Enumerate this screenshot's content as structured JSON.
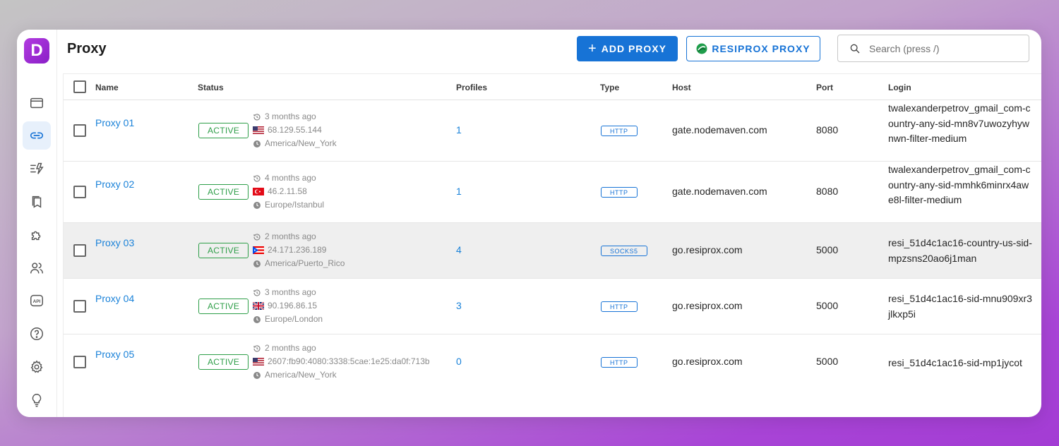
{
  "header": {
    "title": "Proxy",
    "add_button": "ADD PROXY",
    "resiprox_button": "RESIPROX PROXY",
    "search_placeholder": "Search (press /)"
  },
  "sidebar": {
    "logo_letter": "D",
    "items": [
      {
        "name": "browser-icon",
        "active": false
      },
      {
        "name": "link-icon",
        "active": true
      },
      {
        "name": "automation-icon",
        "active": false
      },
      {
        "name": "bookmarks-icon",
        "active": false
      },
      {
        "name": "puzzle-icon",
        "active": false
      },
      {
        "name": "users-icon",
        "active": false
      },
      {
        "name": "api-icon",
        "active": false
      },
      {
        "name": "help-icon",
        "active": false
      },
      {
        "name": "settings-icon",
        "active": false
      },
      {
        "name": "lightbulb-icon",
        "active": false
      }
    ]
  },
  "columns": {
    "name": "Name",
    "status": "Status",
    "profiles": "Profiles",
    "type": "Type",
    "host": "Host",
    "port": "Port",
    "login": "Login"
  },
  "colors": {
    "accent": "#1773d6",
    "active_green": "#2e9e48",
    "brand": "#a32bd6"
  },
  "rows": [
    {
      "name": "Proxy 01",
      "status": "ACTIVE",
      "updated": "3 months ago",
      "flag": "us",
      "ip": "68.129.55.144",
      "timezone": "America/New_York",
      "profiles": "1",
      "type": "HTTP",
      "host": "gate.nodemaven.com",
      "port": "8080",
      "login": "twalexanderpetrov_gmail_com-country-any-sid-mn8v7uwozyhywnwn-filter-medium"
    },
    {
      "name": "Proxy 02",
      "status": "ACTIVE",
      "updated": "4 months ago",
      "flag": "tr",
      "ip": "46.2.11.58",
      "timezone": "Europe/Istanbul",
      "profiles": "1",
      "type": "HTTP",
      "host": "gate.nodemaven.com",
      "port": "8080",
      "login": "twalexanderpetrov_gmail_com-country-any-sid-mmhk6minrx4awe8l-filter-medium"
    },
    {
      "name": "Proxy 03",
      "status": "ACTIVE",
      "updated": "2 months ago",
      "flag": "pr",
      "ip": "24.171.236.189",
      "timezone": "America/Puerto_Rico",
      "profiles": "4",
      "type": "SOCKS5",
      "host": "go.resiprox.com",
      "port": "5000",
      "login": "resi_51d4c1ac16-country-us-sid-mpzsns20ao6j1man"
    },
    {
      "name": "Proxy 04",
      "status": "ACTIVE",
      "updated": "3 months ago",
      "flag": "gb",
      "ip": "90.196.86.15",
      "timezone": "Europe/London",
      "profiles": "3",
      "type": "HTTP",
      "host": "go.resiprox.com",
      "port": "5000",
      "login": "resi_51d4c1ac16-sid-mnu909xr3jlkxp5i"
    },
    {
      "name": "Proxy 05",
      "status": "ACTIVE",
      "updated": "2 months ago",
      "flag": "us",
      "ip": "2607:fb90:4080:3338:5cae:1e25:da0f:713b",
      "timezone": "America/New_York",
      "profiles": "0",
      "type": "HTTP",
      "host": "go.resiprox.com",
      "port": "5000",
      "login": "resi_51d4c1ac16-sid-mp1jycot"
    }
  ]
}
